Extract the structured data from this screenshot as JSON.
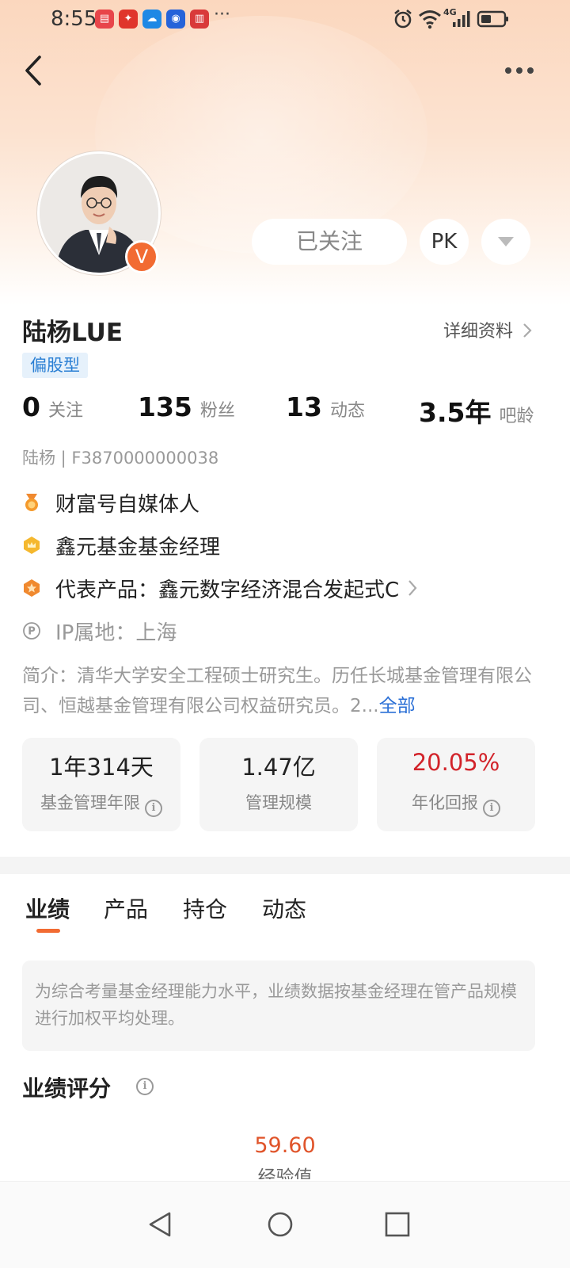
{
  "status_bar": {
    "time": "8:55",
    "more": "···",
    "network": "4G"
  },
  "profile": {
    "name": "陆杨LUE",
    "tag": "偏股型",
    "detail_link": "详细资料",
    "follow_button": "已关注",
    "pk_button": "PK",
    "stats": [
      {
        "value": "0",
        "label": "关注"
      },
      {
        "value": "135",
        "label": "粉丝"
      },
      {
        "value": "13",
        "label": "动态"
      },
      {
        "value": "3.5年",
        "label": "吧龄"
      }
    ],
    "id_line": "陆杨 | F3870000000038",
    "info": [
      {
        "icon": "medal-icon",
        "text": "财富号自媒体人"
      },
      {
        "icon": "crown-badge-icon",
        "text": "鑫元基金基金经理"
      },
      {
        "icon": "star-badge-icon",
        "text": "代表产品：鑫元数字经济混合发起式C"
      },
      {
        "icon": "ip-location-icon",
        "text": "IP属地：上海"
      }
    ],
    "intro": "简介：清华大学安全工程硕士研究生。历任长城基金管理有限公司、恒越基金管理有限公司权益研究员。2...",
    "intro_more": "全部"
  },
  "metrics": [
    {
      "value": "1年314天",
      "label": "基金管理年限",
      "has_info": true,
      "color": "#222222"
    },
    {
      "value": "1.47亿",
      "label": "管理规模",
      "has_info": false,
      "color": "#222222"
    },
    {
      "value": "20.05%",
      "label": "年化回报",
      "has_info": true,
      "color": "#d2232a"
    }
  ],
  "tabs": [
    "业绩",
    "产品",
    "持仓",
    "动态"
  ],
  "active_tab": "业绩",
  "notice": "为综合考量基金经理能力水平，业绩数据按基金经理在管产品规模进行加权平均处理。",
  "performance": {
    "title": "业绩评分",
    "score": "59.60",
    "score_label": "经验值"
  },
  "colors": {
    "accent": "#f26b32",
    "link": "#2a6fd6",
    "positive": "#d2232a"
  }
}
